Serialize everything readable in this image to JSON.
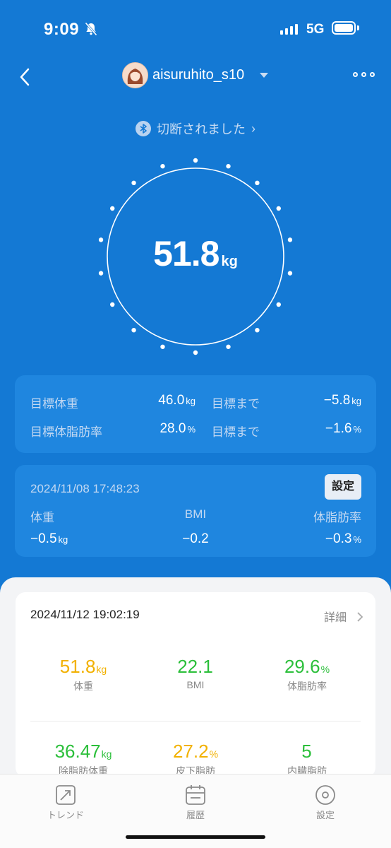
{
  "status_bar": {
    "time": "9:09",
    "network": "5G",
    "icons": [
      "bell-slash-icon",
      "signal-icon",
      "battery-icon"
    ]
  },
  "header": {
    "username": "aisuruhito_s10",
    "icons": [
      "back-chevron-icon",
      "avatar",
      "caret-down-icon",
      "more-icon"
    ]
  },
  "connection": {
    "status": "切断されました",
    "chevron": "›"
  },
  "current": {
    "weight": "51.8",
    "unit": "kg"
  },
  "goals": {
    "weight_label": "目標体重",
    "weight_value": "46.0",
    "weight_unit": "kg",
    "weight_remain_label": "目標まで",
    "weight_remain": "−5.8",
    "weight_remain_unit": "kg",
    "fat_label": "目標体脂肪率",
    "fat_value": "28.0",
    "fat_unit": "%",
    "fat_remain_label": "目標まで",
    "fat_remain": "−1.6",
    "fat_remain_unit": "%"
  },
  "diff": {
    "datetime": "2024/11/08 17:48:23",
    "settings_button": "設定",
    "labels": [
      "体重",
      "BMI",
      "体脂肪率"
    ],
    "weight": "−0.5",
    "weight_unit": "kg",
    "bmi": "−0.2",
    "fat": "−0.3",
    "fat_unit": "%"
  },
  "record": {
    "datetime": "2024/11/12 19:02:19",
    "detail": "詳細",
    "metrics": [
      {
        "value": "51.8",
        "unit": "kg",
        "label": "体重",
        "color": "#f2b100"
      },
      {
        "value": "22.1",
        "unit": "",
        "label": "BMI",
        "color": "#2bbf3a"
      },
      {
        "value": "29.6",
        "unit": "%",
        "label": "体脂肪率",
        "color": "#2bbf3a"
      },
      {
        "value": "36.47",
        "unit": "kg",
        "label": "除脂肪体重",
        "color": "#2bbf3a"
      },
      {
        "value": "27.2",
        "unit": "%",
        "label": "皮下脂肪",
        "color": "#f2b100"
      },
      {
        "value": "5",
        "unit": "",
        "label": "内臓脂肪",
        "color": "#2bbf3a"
      }
    ]
  },
  "tabs": [
    {
      "label": "トレンド",
      "icon": "trend-icon"
    },
    {
      "label": "履歴",
      "icon": "calendar-icon"
    },
    {
      "label": "設定",
      "icon": "settings-icon"
    }
  ],
  "colors": {
    "background": "#1479d4",
    "card": "#1f86df",
    "good": "#2bbf3a",
    "warn": "#f2b100"
  }
}
